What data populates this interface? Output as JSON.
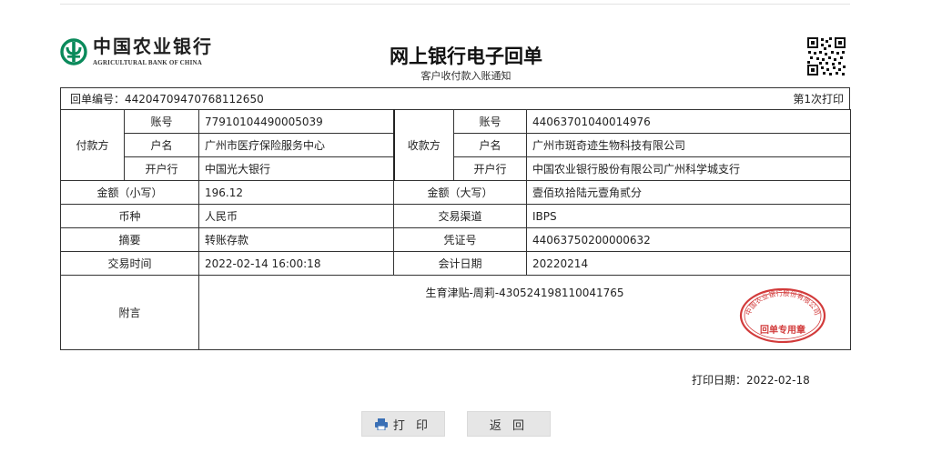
{
  "bank": {
    "name_cn": "中国农业银行",
    "name_en": "AGRICULTURAL BANK OF CHINA",
    "brand_color": "#0a8a5b"
  },
  "header": {
    "title": "网上银行电子回单",
    "subtitle": "客户收付款入账通知"
  },
  "receipt": {
    "number_label": "回单编号：",
    "number": "44204709470768112650",
    "print_count": "第1次打印",
    "payer": {
      "section_label": "付款方",
      "account_label": "账号",
      "account": "77910104490005039",
      "name_label": "户名",
      "name": "广州市医疗保险服务中心",
      "bank_label": "开户行",
      "bank": "中国光大银行"
    },
    "payee": {
      "section_label": "收款方",
      "account_label": "账号",
      "account": "44063701040014976",
      "name_label": "户名",
      "name": "广州市斑奇迹生物科技有限公司",
      "bank_label": "开户行",
      "bank": "中国农业银行股份有限公司广州科学城支行"
    },
    "amount_small_label": "金额（小写）",
    "amount_small": "196.12",
    "amount_big_label": "金额（大写）",
    "amount_big": "壹佰玖拾陆元壹角贰分",
    "currency_label": "币种",
    "currency": "人民币",
    "channel_label": "交易渠道",
    "channel": "IBPS",
    "summary_label": "摘要",
    "summary": "转账存款",
    "voucher_label": "凭证号",
    "voucher": "44063750200000632",
    "time_label": "交易时间",
    "time": "2022-02-14 16:00:18",
    "acct_date_label": "会计日期",
    "acct_date": "20220214",
    "remark_label": "附言",
    "remark": "生育津贴-周莉-430524198110041765",
    "stamp_top": "中国农业银行股份有限公司",
    "stamp_bottom": "回单专用章",
    "stamp_color": "#d23b3b"
  },
  "footer": {
    "print_date": "打印日期：2022-02-18"
  },
  "buttons": {
    "print_label": "打 印",
    "back_label": "返 回",
    "print_icon": "printer-icon"
  }
}
